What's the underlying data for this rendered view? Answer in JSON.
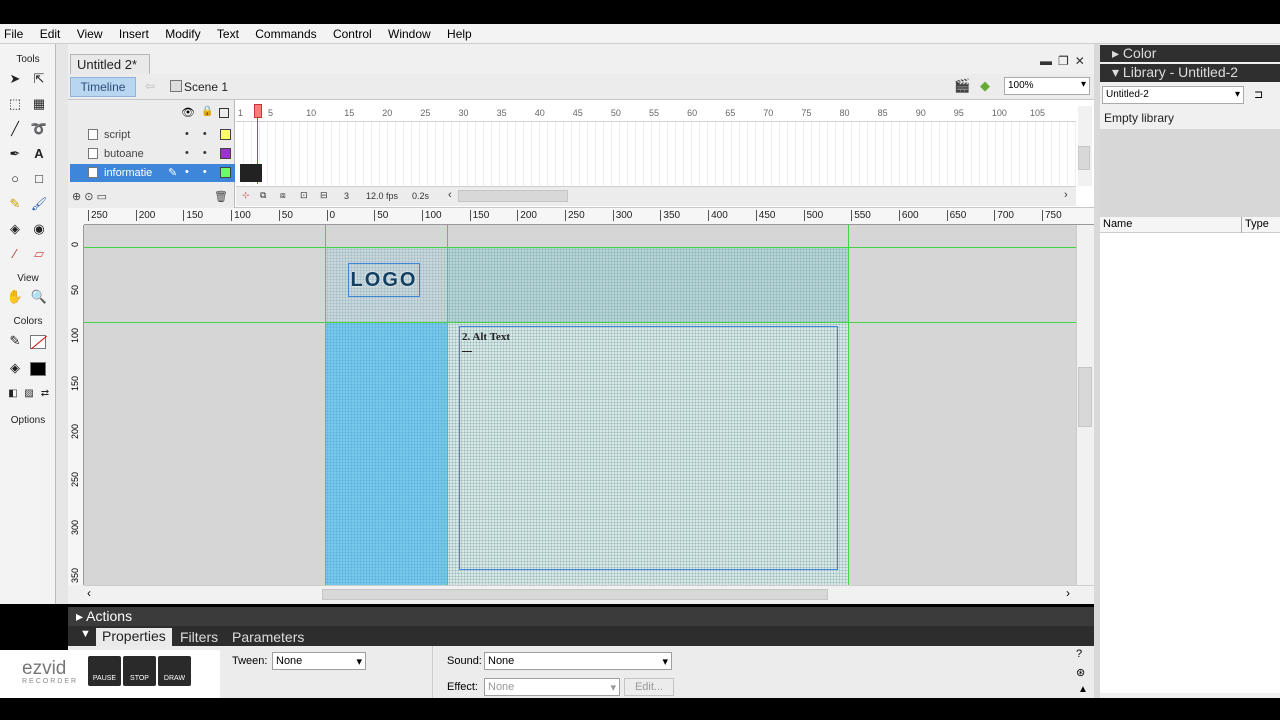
{
  "menu": [
    "File",
    "Edit",
    "View",
    "Insert",
    "Modify",
    "Text",
    "Commands",
    "Control",
    "Window",
    "Help"
  ],
  "tools_panel": {
    "tools_label": "Tools",
    "view_label": "View",
    "colors_label": "Colors",
    "options_label": "Options"
  },
  "document": {
    "tab_title": "Untitled 2*",
    "timeline_button": "Timeline",
    "scene": "Scene 1",
    "zoom": "100%"
  },
  "timeline": {
    "layers": [
      {
        "name": "script",
        "color": "#ffff66",
        "selected": false
      },
      {
        "name": "butoane",
        "color": "#9933cc",
        "selected": false
      },
      {
        "name": "informatie",
        "color": "#66ff66",
        "selected": true
      }
    ],
    "frame_numbers": [
      "1",
      "5",
      "10",
      "15",
      "20",
      "25",
      "30",
      "35",
      "40",
      "45",
      "50",
      "55",
      "60",
      "65",
      "70",
      "75",
      "80",
      "85",
      "90",
      "95",
      "100",
      "105"
    ],
    "current_frame": "3",
    "fps": "12.0 fps",
    "elapsed": "0.2s"
  },
  "ruler_h": [
    "250",
    "200",
    "150",
    "100",
    "50",
    "0",
    "50",
    "100",
    "150",
    "200",
    "250",
    "300",
    "350",
    "400",
    "450",
    "500",
    "550",
    "600",
    "650",
    "700",
    "750"
  ],
  "ruler_v": [
    "0",
    "50",
    "100",
    "150",
    "200",
    "250",
    "300",
    "350"
  ],
  "stage": {
    "logo_text": "LOGO",
    "text_field": "2. Alt Text"
  },
  "panels": {
    "actions": "Actions",
    "properties_tabs": [
      "Properties",
      "Filters",
      "Parameters"
    ]
  },
  "properties": {
    "tween_label": "Tween:",
    "tween_value": "None",
    "sound_label": "Sound:",
    "sound_value": "None",
    "effect_label": "Effect:",
    "effect_value": "None",
    "edit_btn": "Edit..."
  },
  "library": {
    "color_header": "Color",
    "library_header": "Library - Untitled-2",
    "doc_select": "Untitled-2",
    "empty": "Empty library",
    "col_name": "Name",
    "col_type": "Type"
  },
  "ezvid": {
    "logo": "ezvid",
    "sub": "RECORDER",
    "pause": "PAUSE",
    "stop": "STOP",
    "draw": "DRAW"
  }
}
